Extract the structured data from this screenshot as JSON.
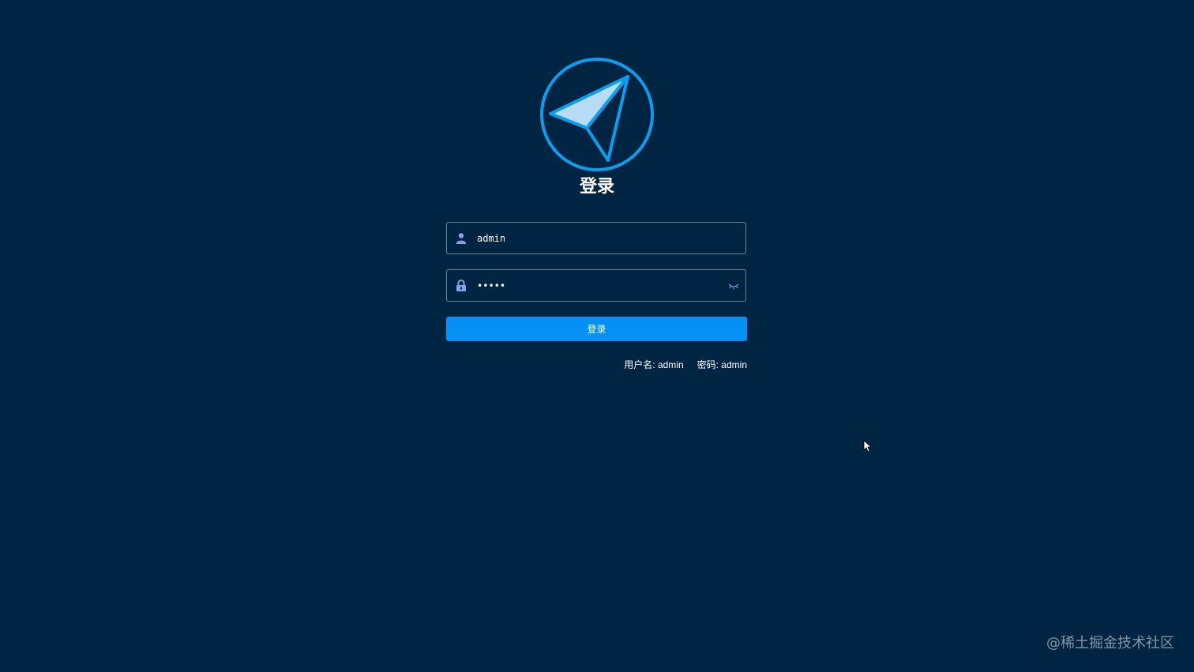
{
  "colors": {
    "background": "#002543",
    "primary": "#0590f4",
    "logo_ring": "#0a9ef0",
    "logo_fill": "#b8dcf6",
    "icon": "#8a9ee8"
  },
  "logo": {
    "icon": "paper-plane-icon"
  },
  "login": {
    "title": "登录",
    "username": {
      "icon": "user-icon",
      "value": "admin",
      "placeholder": ""
    },
    "password": {
      "icon": "lock-icon",
      "value": "admin",
      "placeholder": "",
      "toggle_icon": "eye-closed-icon"
    },
    "submit_label": "登录",
    "hint_username": "用户名: admin",
    "hint_password": "密码: admin"
  },
  "watermark": "@稀土掘金技术社区"
}
